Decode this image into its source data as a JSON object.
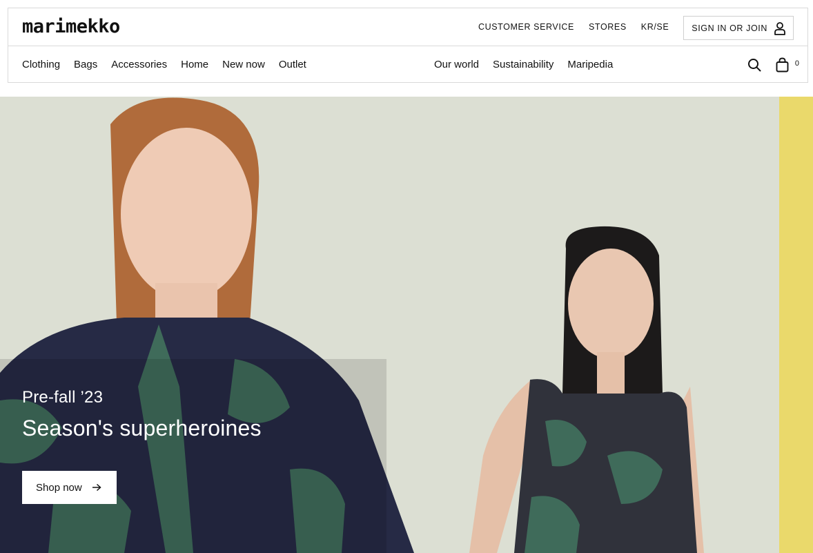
{
  "brand": {
    "logo": "marimekko"
  },
  "top_links": {
    "customer_service": "CUSTOMER SERVICE",
    "stores": "STORES",
    "locale": "KR/SE",
    "signin": "SIGN IN OR JOIN"
  },
  "nav": {
    "primary": [
      {
        "label": "Clothing"
      },
      {
        "label": "Bags"
      },
      {
        "label": "Accessories"
      },
      {
        "label": "Home"
      },
      {
        "label": "New now"
      },
      {
        "label": "Outlet"
      }
    ],
    "secondary": [
      {
        "label": "Our world"
      },
      {
        "label": "Sustainability"
      },
      {
        "label": "Maripedia"
      }
    ]
  },
  "cart": {
    "count": "0"
  },
  "hero": {
    "eyebrow": "Pre-fall ’23",
    "title": "Season's superheroines",
    "cta": "Shop now"
  },
  "icons": {
    "search": "search-icon",
    "cart": "shopping-bag-icon",
    "user": "user-icon",
    "arrow": "arrow-right-icon"
  },
  "colors": {
    "hero_backdrop": "#dcdfd3",
    "accent_yellow": "#ead96b",
    "garment_navy": "#262a45",
    "garment_green": "#3f6b5a"
  }
}
